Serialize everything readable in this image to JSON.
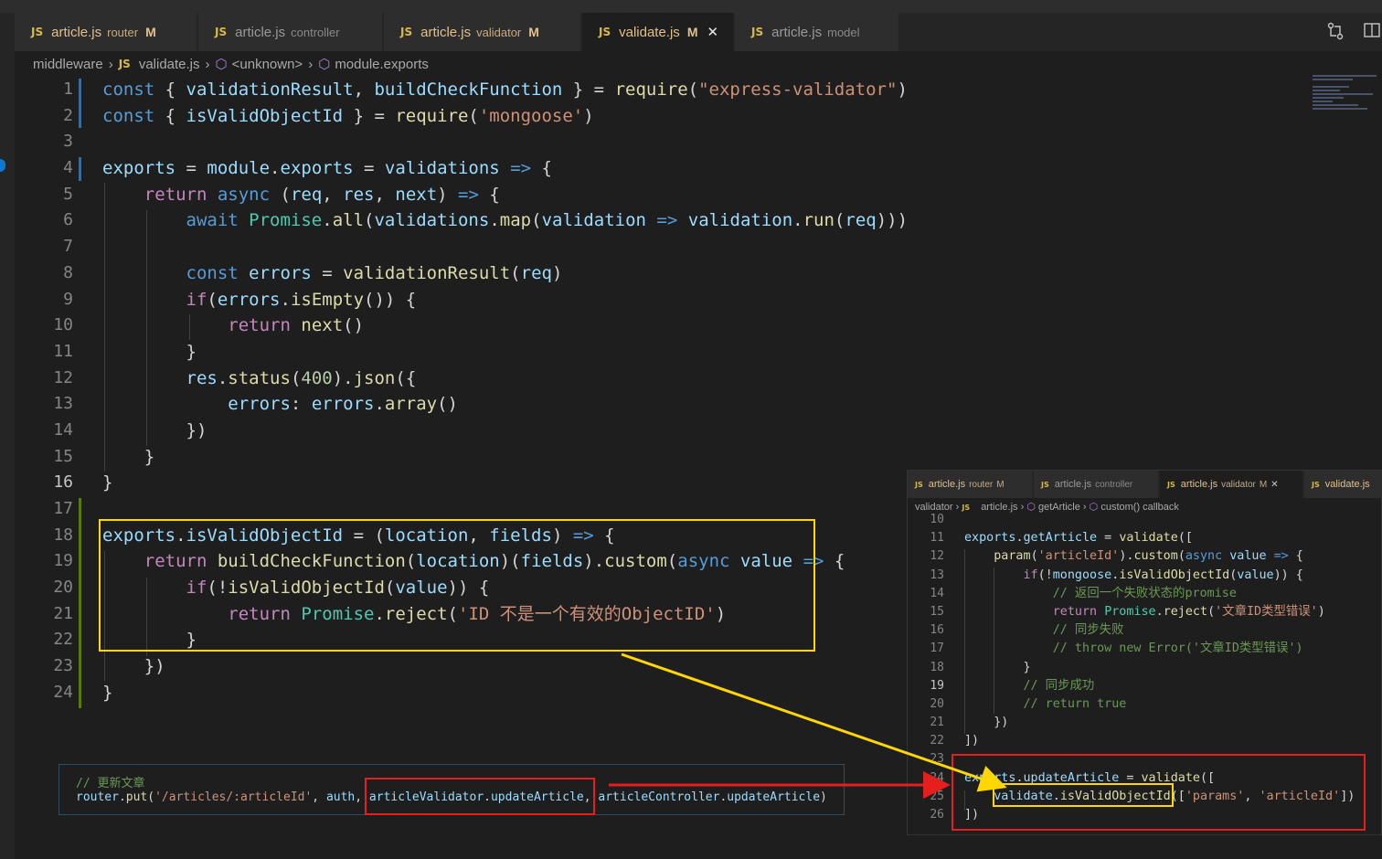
{
  "tabs": [
    {
      "name": "article.js",
      "desc": "router",
      "badge": "M"
    },
    {
      "name": "article.js",
      "desc": "controller",
      "badge": ""
    },
    {
      "name": "article.js",
      "desc": "validator",
      "badge": "M"
    },
    {
      "name": "validate.js",
      "desc": "",
      "badge": "M",
      "close": "✕"
    },
    {
      "name": "article.js",
      "desc": "model",
      "badge": ""
    }
  ],
  "js_icon": "JS",
  "breadcrumb": [
    "middleware",
    "validate.js",
    "<unknown>",
    "module.exports"
  ],
  "editor": {
    "line_numbers": [
      "1",
      "2",
      "3",
      "4",
      "5",
      "6",
      "7",
      "8",
      "9",
      "10",
      "11",
      "12",
      "13",
      "14",
      "15",
      "16",
      "17",
      "18",
      "19",
      "20",
      "21",
      "22",
      "23",
      "24"
    ],
    "lines": [
      "const { validationResult, buildCheckFunction } = require(\"express-validator\")",
      "const { isValidObjectId } = require('mongoose')",
      "",
      "exports = module.exports = validations => {",
      "    return async (req, res, next) => {",
      "        await Promise.all(validations.map(validation => validation.run(req)))",
      "",
      "        const errors = validationResult(req)",
      "        if(errors.isEmpty()) {",
      "            return next()",
      "        }",
      "        res.status(400).json({",
      "            errors: errors.array()",
      "        })",
      "    }",
      "}",
      "",
      "exports.isValidObjectId = (location, fields) => {",
      "    return buildCheckFunction(location)(fields).custom(async value => {",
      "        if(!isValidObjectId(value)) {",
      "            return Promise.reject('ID 不是一个有效的ObjectID')",
      "        }",
      "    })",
      "}"
    ]
  },
  "snippet": {
    "comment": "// 更新文章",
    "code": "router.put('/articles/:articleId', auth, articleValidator.updateArticle, articleController.updateArticle)"
  },
  "panel": {
    "tabs": [
      {
        "name": "article.js",
        "desc": "router",
        "badge": "M"
      },
      {
        "name": "article.js",
        "desc": "controller",
        "badge": ""
      },
      {
        "name": "article.js",
        "desc": "validator",
        "badge": "M",
        "close": "✕"
      },
      {
        "name": "validate.js",
        "desc": "",
        "badge": ""
      }
    ],
    "breadcrumb": [
      "validator",
      "article.js",
      "getArticle",
      "custom() callback"
    ],
    "line_numbers": [
      "10",
      "11",
      "12",
      "13",
      "14",
      "15",
      "16",
      "17",
      "18",
      "19",
      "20",
      "21",
      "22",
      "23",
      "24",
      "25",
      "26"
    ],
    "lines": [
      "",
      "exports.getArticle = validate([",
      "    param('articleId').custom(async value => {",
      "        if(!mongoose.isValidObjectId(value)) {",
      "            // 返回一个失败状态的promise",
      "            return Promise.reject('文章ID类型错误')",
      "            // 同步失败",
      "            // throw new Error('文章ID类型错误')",
      "        }",
      "        // 同步成功",
      "        // return true",
      "    })",
      "])",
      "",
      "exports.updateArticle = validate([",
      "    validate.isValidObjectId(['params', 'articleId'])",
      "])"
    ]
  },
  "colors": {
    "background": "#1e1e1e",
    "highlight_box": "#ffd700",
    "callout_box": "#e51e1e",
    "keyword": "#569cd6",
    "string": "#ce9178",
    "function": "#dcdcaa",
    "variable": "#9cdcfe",
    "comment": "#6a9955"
  },
  "icons": [
    "compare-changes-icon",
    "split-editor-icon",
    "symbol-icon"
  ]
}
